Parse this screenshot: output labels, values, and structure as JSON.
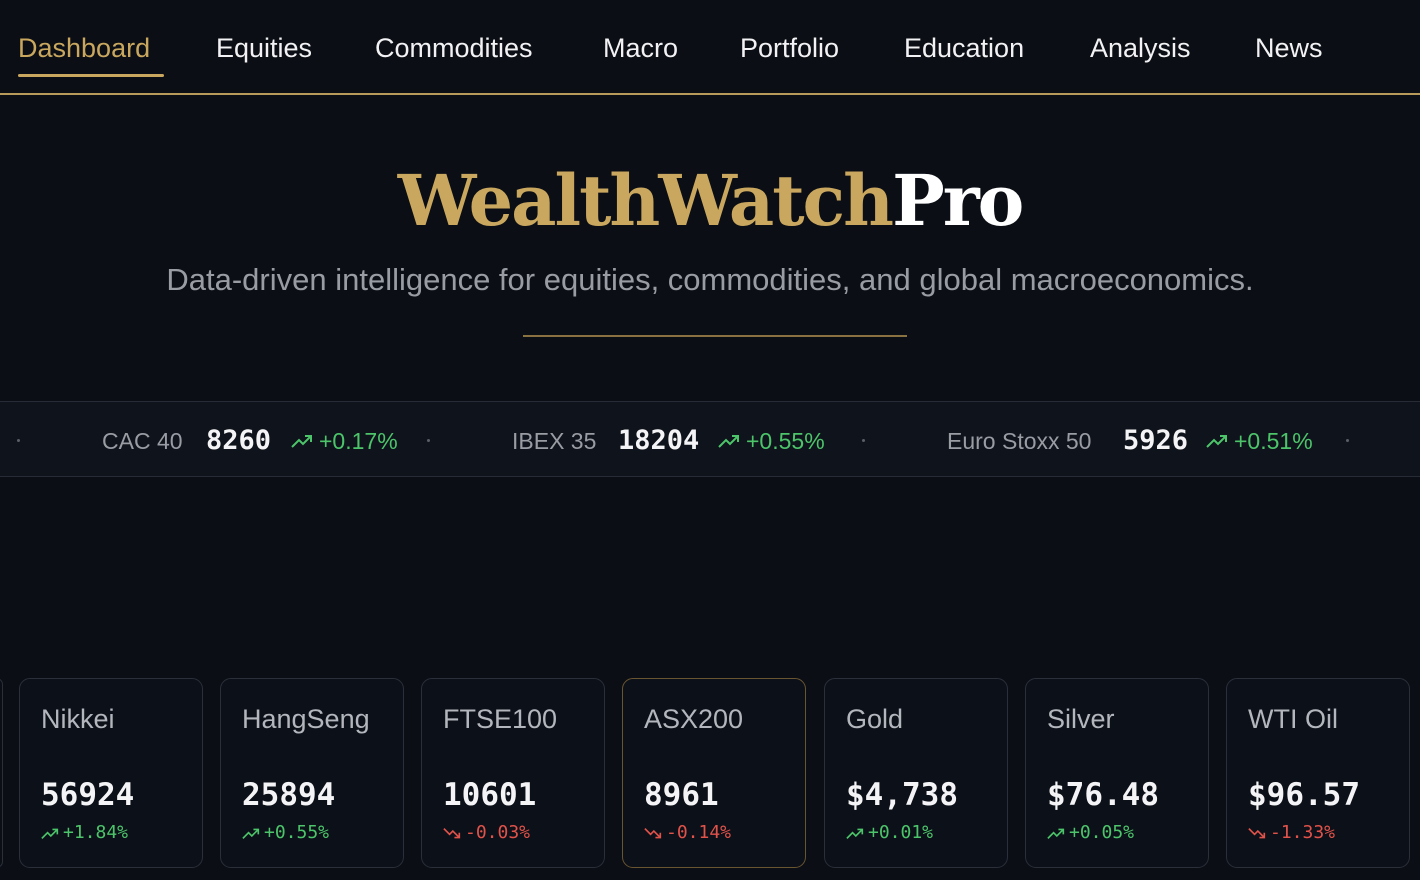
{
  "nav": {
    "items": [
      {
        "label": "Dashboard",
        "active": true
      },
      {
        "label": "Equities"
      },
      {
        "label": "Commodities"
      },
      {
        "label": "Macro"
      },
      {
        "label": "Portfolio"
      },
      {
        "label": "Education"
      },
      {
        "label": "Analysis"
      },
      {
        "label": "News"
      }
    ]
  },
  "hero": {
    "brand": "WealthWatch",
    "suffix": "Pro",
    "subtitle": "Data-driven intelligence for equities, commodities, and global macroeconomics."
  },
  "ticker": {
    "items": [
      {
        "name": "CAC 40",
        "value": "8260",
        "change": "+0.17%",
        "direction": "up",
        "icon": "trend-up-icon"
      },
      {
        "name": "IBEX 35",
        "value": "18204",
        "change": "+0.55%",
        "direction": "up",
        "icon": "trend-up-icon"
      },
      {
        "name": "Euro Stoxx 50",
        "value": "5926",
        "change": "+0.51%",
        "direction": "up",
        "icon": "trend-up-icon"
      }
    ]
  },
  "cards": [
    {
      "name": "Nikkei",
      "value": "56924",
      "change": "+1.84%",
      "direction": "up"
    },
    {
      "name": "HangSeng",
      "value": "25894",
      "change": "+0.55%",
      "direction": "up"
    },
    {
      "name": "FTSE100",
      "value": "10601",
      "change": "-0.03%",
      "direction": "down"
    },
    {
      "name": "ASX200",
      "value": "8961",
      "change": "-0.14%",
      "direction": "down",
      "highlight": true
    },
    {
      "name": "Gold",
      "value": "$4,738",
      "change": "+0.01%",
      "direction": "up"
    },
    {
      "name": "Silver",
      "value": "$76.48",
      "change": "+0.05%",
      "direction": "up"
    },
    {
      "name": "WTI Oil",
      "value": "$96.57",
      "change": "-1.33%",
      "direction": "down"
    }
  ],
  "colors": {
    "accent": "#c9a75e",
    "background": "#0b0e15",
    "up": "#4cc56a",
    "down": "#e0524a"
  }
}
